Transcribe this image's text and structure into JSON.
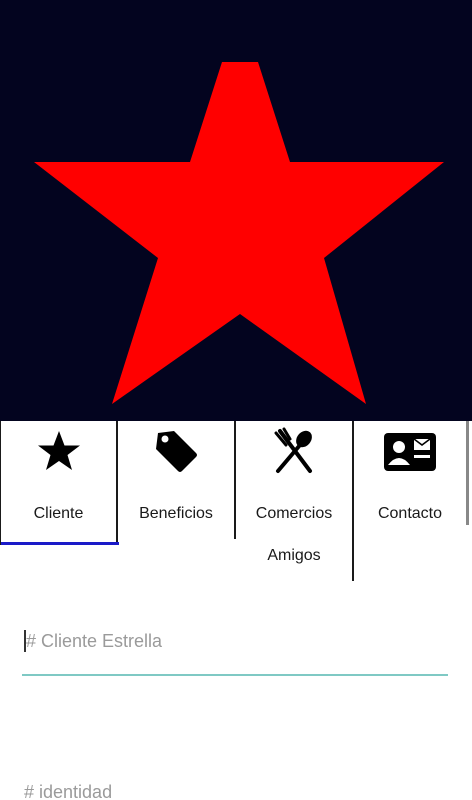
{
  "hero": {
    "logo_icon": "red-star",
    "accent": "#ff0000",
    "background": "#03041f"
  },
  "tabs": [
    {
      "label": "Cliente",
      "icon": "star-icon",
      "selected": true
    },
    {
      "label": "Beneficios",
      "icon": "tag-icon",
      "selected": false
    },
    {
      "label": "Comercios Amigos",
      "icon": "fork-spoon-icon",
      "selected": false
    },
    {
      "label": "Contacto",
      "icon": "contact-card-icon",
      "selected": false
    }
  ],
  "colors": {
    "tab_indicator": "#1a1ac8",
    "field_underline": "#7fc9c4"
  },
  "form": {
    "cliente_placeholder": "# Cliente Estrella",
    "identidad_placeholder": "# identidad"
  }
}
